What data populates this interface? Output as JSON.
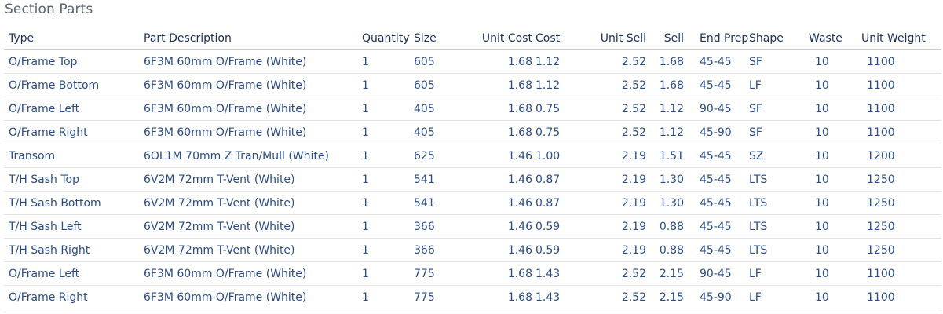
{
  "section": {
    "title": "Section Parts"
  },
  "table": {
    "headers": {
      "type": "Type",
      "description": "Part Description",
      "quantity": "Quantity",
      "size": "Size",
      "unit_cost": "Unit Cost",
      "cost": "Cost",
      "unit_sell": "Unit Sell",
      "sell": "Sell",
      "end_prep": "End Prep",
      "shape": "Shape",
      "waste": "Waste",
      "unit_weight": "Unit Weight"
    },
    "rows": [
      {
        "type": "O/Frame Top",
        "description": "6F3M 60mm O/Frame (White)",
        "quantity": "1",
        "size": "605",
        "unit_cost": "1.68",
        "cost": "1.12",
        "unit_sell": "2.52",
        "sell": "1.68",
        "end_prep": "45-45",
        "shape": "SF",
        "waste": "10",
        "unit_weight": "1100"
      },
      {
        "type": "O/Frame Bottom",
        "description": "6F3M 60mm O/Frame (White)",
        "quantity": "1",
        "size": "605",
        "unit_cost": "1.68",
        "cost": "1.12",
        "unit_sell": "2.52",
        "sell": "1.68",
        "end_prep": "45-45",
        "shape": "LF",
        "waste": "10",
        "unit_weight": "1100"
      },
      {
        "type": "O/Frame Left",
        "description": "6F3M 60mm O/Frame (White)",
        "quantity": "1",
        "size": "405",
        "unit_cost": "1.68",
        "cost": "0.75",
        "unit_sell": "2.52",
        "sell": "1.12",
        "end_prep": "90-45",
        "shape": "SF",
        "waste": "10",
        "unit_weight": "1100"
      },
      {
        "type": "O/Frame Right",
        "description": "6F3M 60mm O/Frame (White)",
        "quantity": "1",
        "size": "405",
        "unit_cost": "1.68",
        "cost": "0.75",
        "unit_sell": "2.52",
        "sell": "1.12",
        "end_prep": "45-90",
        "shape": "SF",
        "waste": "10",
        "unit_weight": "1100"
      },
      {
        "type": "Transom",
        "description": "6OL1M 70mm Z Tran/Mull (White)",
        "quantity": "1",
        "size": "625",
        "unit_cost": "1.46",
        "cost": "1.00",
        "unit_sell": "2.19",
        "sell": "1.51",
        "end_prep": "45-45",
        "shape": "SZ",
        "waste": "10",
        "unit_weight": "1200"
      },
      {
        "type": "T/H Sash Top",
        "description": "6V2M 72mm T-Vent (White)",
        "quantity": "1",
        "size": "541",
        "unit_cost": "1.46",
        "cost": "0.87",
        "unit_sell": "2.19",
        "sell": "1.30",
        "end_prep": "45-45",
        "shape": "LTS",
        "waste": "10",
        "unit_weight": "1250"
      },
      {
        "type": "T/H Sash Bottom",
        "description": "6V2M 72mm T-Vent (White)",
        "quantity": "1",
        "size": "541",
        "unit_cost": "1.46",
        "cost": "0.87",
        "unit_sell": "2.19",
        "sell": "1.30",
        "end_prep": "45-45",
        "shape": "LTS",
        "waste": "10",
        "unit_weight": "1250"
      },
      {
        "type": "T/H Sash Left",
        "description": "6V2M 72mm T-Vent (White)",
        "quantity": "1",
        "size": "366",
        "unit_cost": "1.46",
        "cost": "0.59",
        "unit_sell": "2.19",
        "sell": "0.88",
        "end_prep": "45-45",
        "shape": "LTS",
        "waste": "10",
        "unit_weight": "1250"
      },
      {
        "type": "T/H Sash Right",
        "description": "6V2M 72mm T-Vent (White)",
        "quantity": "1",
        "size": "366",
        "unit_cost": "1.46",
        "cost": "0.59",
        "unit_sell": "2.19",
        "sell": "0.88",
        "end_prep": "45-45",
        "shape": "LTS",
        "waste": "10",
        "unit_weight": "1250"
      },
      {
        "type": "O/Frame Left",
        "description": "6F3M 60mm O/Frame (White)",
        "quantity": "1",
        "size": "775",
        "unit_cost": "1.68",
        "cost": "1.43",
        "unit_sell": "2.52",
        "sell": "2.15",
        "end_prep": "90-45",
        "shape": "LF",
        "waste": "10",
        "unit_weight": "1100"
      },
      {
        "type": "O/Frame Right",
        "description": "6F3M 60mm O/Frame (White)",
        "quantity": "1",
        "size": "775",
        "unit_cost": "1.68",
        "cost": "1.43",
        "unit_sell": "2.52",
        "sell": "2.15",
        "end_prep": "45-90",
        "shape": "LF",
        "waste": "10",
        "unit_weight": "1100"
      }
    ]
  }
}
